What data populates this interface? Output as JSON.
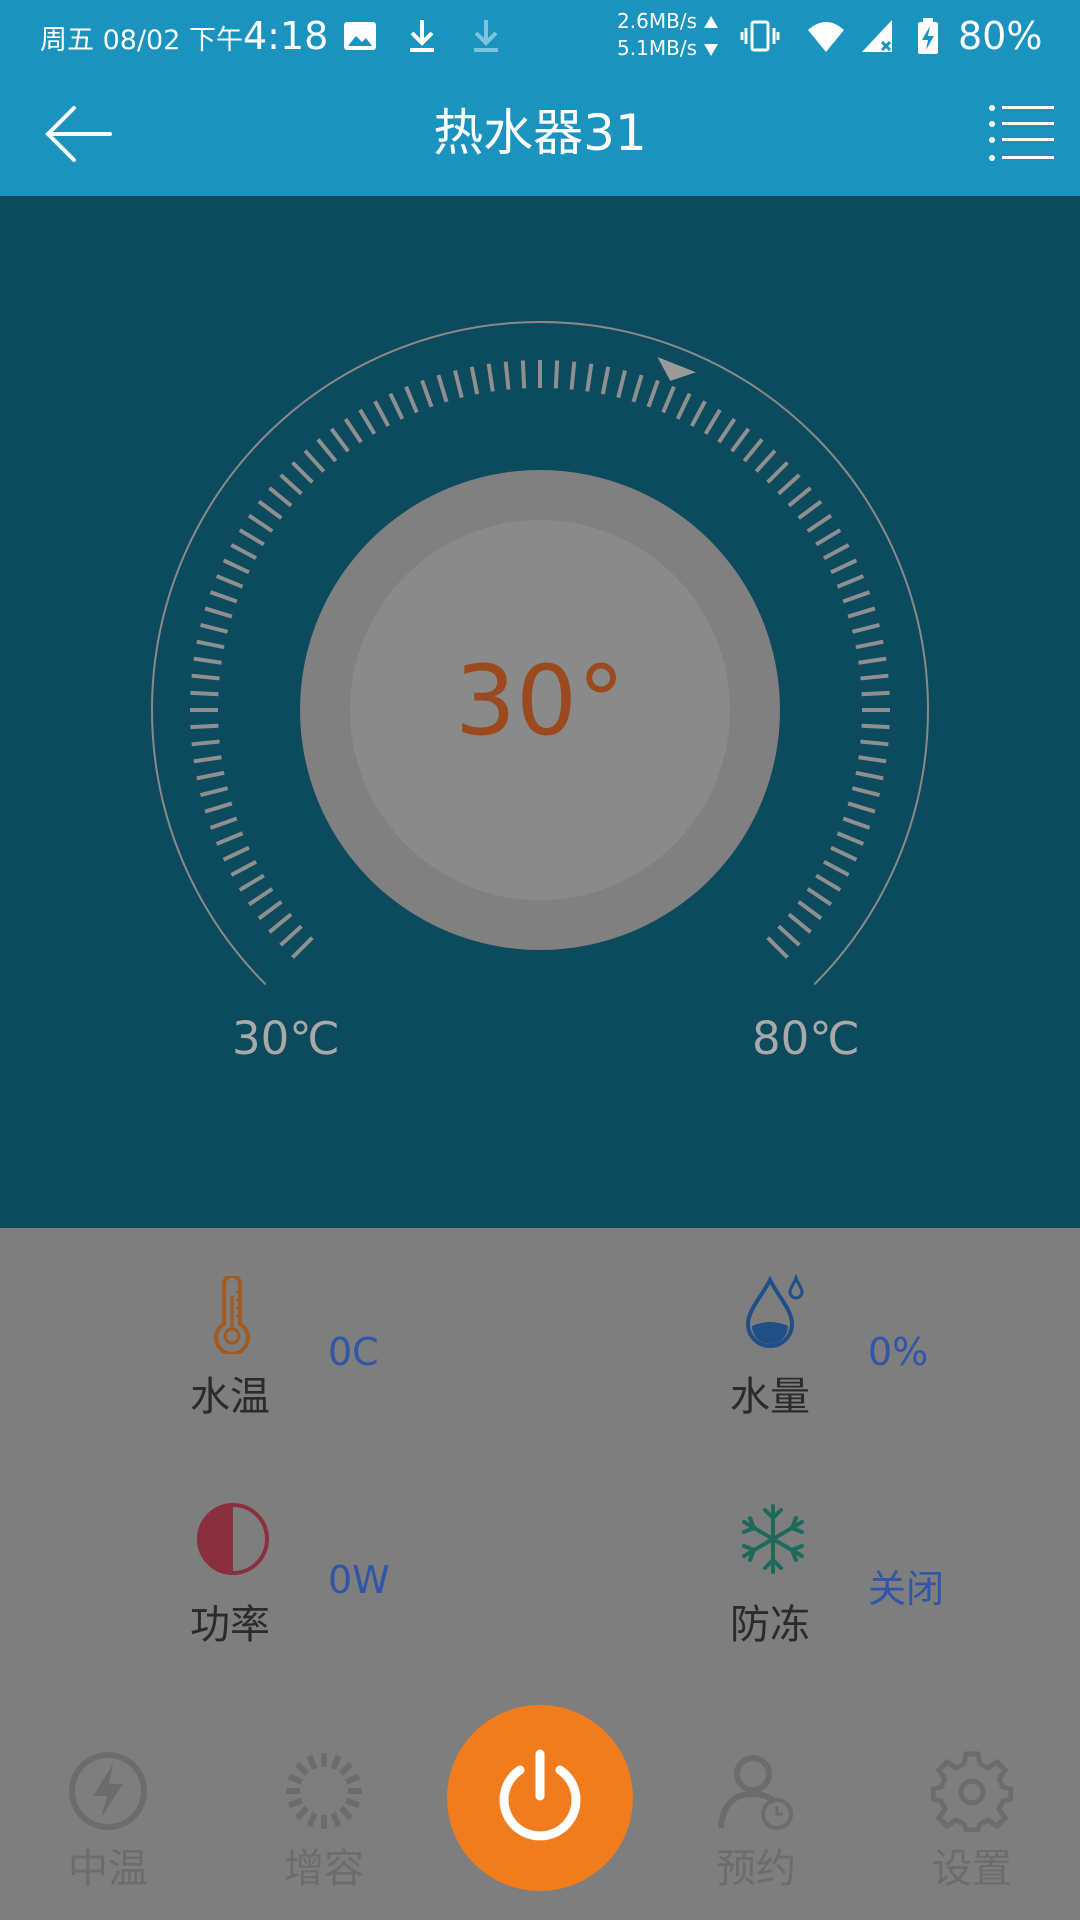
{
  "status_bar": {
    "day_date": "周五 08/02",
    "ampm": "下午",
    "time": "4:18",
    "upload_speed": "2.6MB/s",
    "download_speed": "5.1MB/s",
    "battery": "80%",
    "icons": [
      "image-icon",
      "download-icon",
      "download-icon",
      "net-arrows-icon",
      "vibrate-icon",
      "wifi-icon",
      "signal-icon",
      "battery-charging-icon"
    ]
  },
  "app_bar": {
    "title": "热水器31",
    "back_icon": "arrow-left-icon",
    "menu_icon": "menu-list-icon"
  },
  "dial": {
    "current_temp": "30°",
    "min_label": "30℃",
    "max_label": "80℃",
    "min": 30,
    "max": 80,
    "value": 30,
    "indicator_fraction": 0.58
  },
  "info": {
    "water_temp": {
      "label": "水温",
      "value": "0C",
      "icon": "thermometer-icon",
      "color": "#a35a1e"
    },
    "water_level": {
      "label": "水量",
      "value": "0%",
      "icon": "water-drop-icon",
      "color": "#1f4f86"
    },
    "power": {
      "label": "功率",
      "value": "0W",
      "icon": "half-circle-icon",
      "color": "#8a2f3d"
    },
    "antifreeze": {
      "label": "防冻",
      "value": "关闭",
      "icon": "snowflake-icon",
      "color": "#1d6a5a"
    }
  },
  "bottom_nav": {
    "items": [
      {
        "label": "中温",
        "icon": "lightning-icon"
      },
      {
        "label": "增容",
        "icon": "spinner-icon"
      },
      {
        "label": "预约",
        "icon": "user-clock-icon"
      },
      {
        "label": "设置",
        "icon": "gear-icon"
      }
    ],
    "power_icon": "power-icon",
    "power_color": "#f07c1e"
  },
  "colors": {
    "primary": "#1a93bf",
    "dial_bg": "#0c4a5e",
    "panel_bg": "#7e7e7e",
    "value_text": "#2f56a8",
    "temp_text": "#9b4a20"
  }
}
